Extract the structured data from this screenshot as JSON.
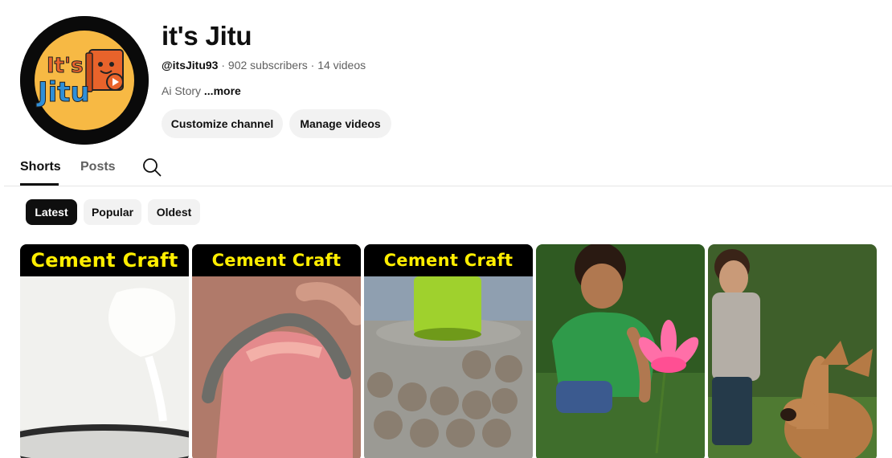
{
  "channel": {
    "logo_text_top": "It's",
    "logo_text_bottom": "Jitu",
    "name": "it's Jitu",
    "handle": "@itsJitu93",
    "subscribers": "902 subscribers",
    "videos": "14 videos",
    "separator": " · ",
    "description": "Ai Story ",
    "more": "...more"
  },
  "buttons": {
    "customize": "Customize channel",
    "manage": "Manage videos"
  },
  "tabs": [
    {
      "label": "Shorts",
      "active": true
    },
    {
      "label": "Posts",
      "active": false
    }
  ],
  "filters": [
    {
      "label": "Latest",
      "active": true
    },
    {
      "label": "Popular",
      "active": false
    },
    {
      "label": "Oldest",
      "active": false
    }
  ],
  "shorts": [
    {
      "banner": "Cement Craft"
    },
    {
      "banner": "Cement Craft"
    },
    {
      "banner": "Cement Craft"
    },
    {
      "banner": ""
    },
    {
      "banner": ""
    }
  ],
  "colors": {
    "logo_bg": "#f7b944",
    "logo_orange": "#e8632b",
    "logo_blue": "#2f8fd8",
    "chip_active": "#0f0f0f",
    "banner_text": "#ffee00"
  },
  "icons": {
    "search": "search-icon"
  }
}
